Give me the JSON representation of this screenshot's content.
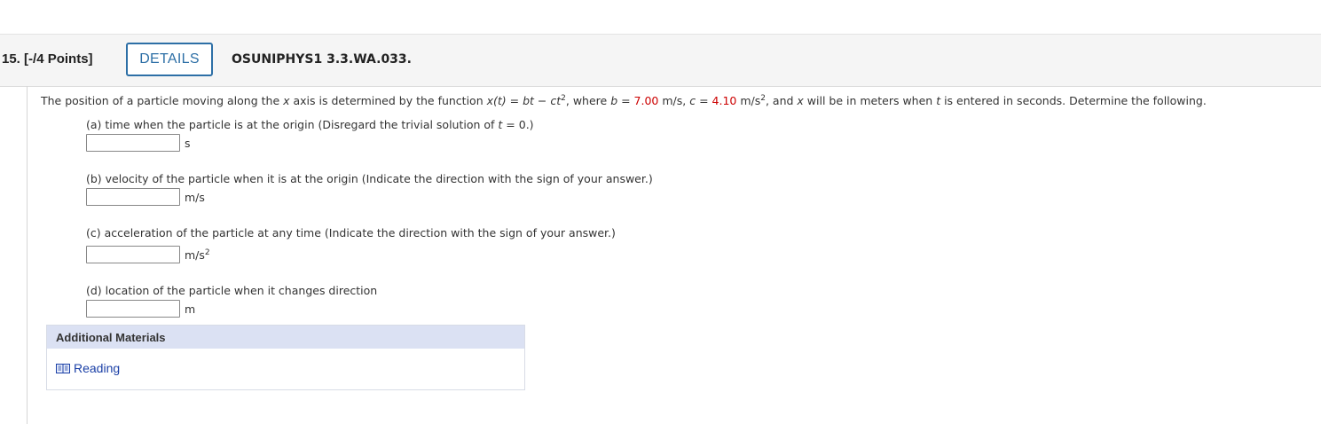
{
  "header": {
    "question_number": "15.",
    "points": "[-/4 Points]",
    "details_label": "DETAILS",
    "assignment_code": "OSUNIPHYS1 3.3.WA.033."
  },
  "question": {
    "intro_1": "The position of a particle moving along the ",
    "var_x": "x",
    "intro_2": " axis is determined by the function ",
    "func_lhs": "x(t)",
    "eq": " = ",
    "func_b": "bt",
    "minus": " − ",
    "func_c": "ct",
    "exp_2": "2",
    "intro_3": ", where ",
    "var_b": "b",
    "b_eq": " = ",
    "b_value": "7.00",
    "b_unit": " m/s, ",
    "var_c": "c",
    "c_eq": " = ",
    "c_value": "4.10",
    "c_unit": " m/s",
    "intro_4": ", and ",
    "var_x2": "x",
    "intro_5": " will be in meters when ",
    "var_t": "t",
    "intro_6": " is entered in seconds. Determine the following."
  },
  "parts": [
    {
      "label_before": "(a) time when the particle is at the origin (Disregard the trivial solution of ",
      "label_var": "t",
      "label_after": " = 0.)",
      "value": "",
      "unit": "s",
      "unit_exp": ""
    },
    {
      "label": "(b) velocity of the particle when it is at the origin (Indicate the direction with the sign of your answer.)",
      "value": "",
      "unit": "m/s",
      "unit_exp": ""
    },
    {
      "label": "(c) acceleration of the particle at any time (Indicate the direction with the sign of your answer.)",
      "value": "",
      "unit": "m/s",
      "unit_exp": "2"
    },
    {
      "label": "(d) location of the particle when it changes direction",
      "value": "",
      "unit": "m",
      "unit_exp": ""
    }
  ],
  "materials": {
    "title": "Additional Materials",
    "links": [
      {
        "label": "Reading",
        "icon": "book-icon"
      }
    ]
  },
  "colors": {
    "accent_blue": "#2d6fa6",
    "value_red": "#cc0000",
    "materials_header_bg": "#dbe1f3",
    "link_blue": "#1a3fa6"
  }
}
